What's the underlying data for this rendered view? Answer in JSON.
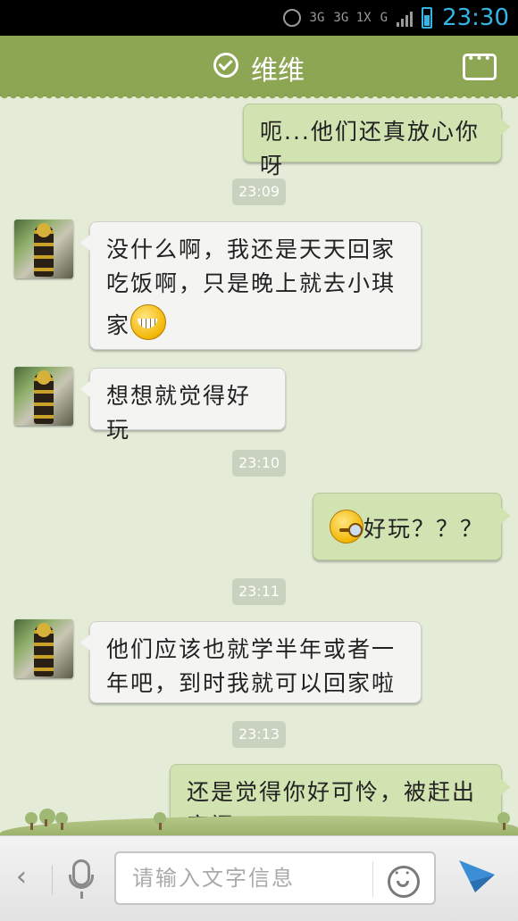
{
  "status_bar": {
    "time": "23:30",
    "network_label_1": "3G",
    "network_label_2": "3G 1X",
    "network_label_3": "G"
  },
  "header": {
    "title": "维维",
    "verified_icon": "check-circle-icon",
    "more_icon": "more-dots-icon"
  },
  "messages": [
    {
      "type": "out",
      "text": "呃...他们还真放心你呀"
    },
    {
      "type": "time",
      "text": "23:09"
    },
    {
      "type": "in",
      "line1": "没什么啊，我还是天天回家",
      "line2": "吃饭啊，只是晚上就去小琪",
      "line3": "家",
      "emoji": "grin-emoji"
    },
    {
      "type": "in",
      "text": "想想就觉得好玩"
    },
    {
      "type": "time",
      "text": "23:10"
    },
    {
      "type": "out",
      "text": "好玩？？？",
      "emoji": "thinking-emoji"
    },
    {
      "type": "time",
      "text": "23:11"
    },
    {
      "type": "in",
      "line1": "他们应该也就学半年或者一",
      "line2": "年吧，到时我就可以回家啦"
    },
    {
      "type": "time",
      "text": "23:13"
    },
    {
      "type": "out",
      "line1": "还是觉得你好可怜，被赶出",
      "line2": "家门"
    }
  ],
  "input_bar": {
    "placeholder": "请输入文字信息",
    "back_icon": "chevron-left-icon",
    "mic_icon": "microphone-icon",
    "emoji_icon": "smiley-icon",
    "send_icon": "send-icon"
  },
  "colors": {
    "header": "#8da654",
    "outgoing_bubble": "#d1e3b0",
    "incoming_bubble": "#f4f4f2",
    "background": "#e4ecd8",
    "clock": "#33b5e5"
  }
}
